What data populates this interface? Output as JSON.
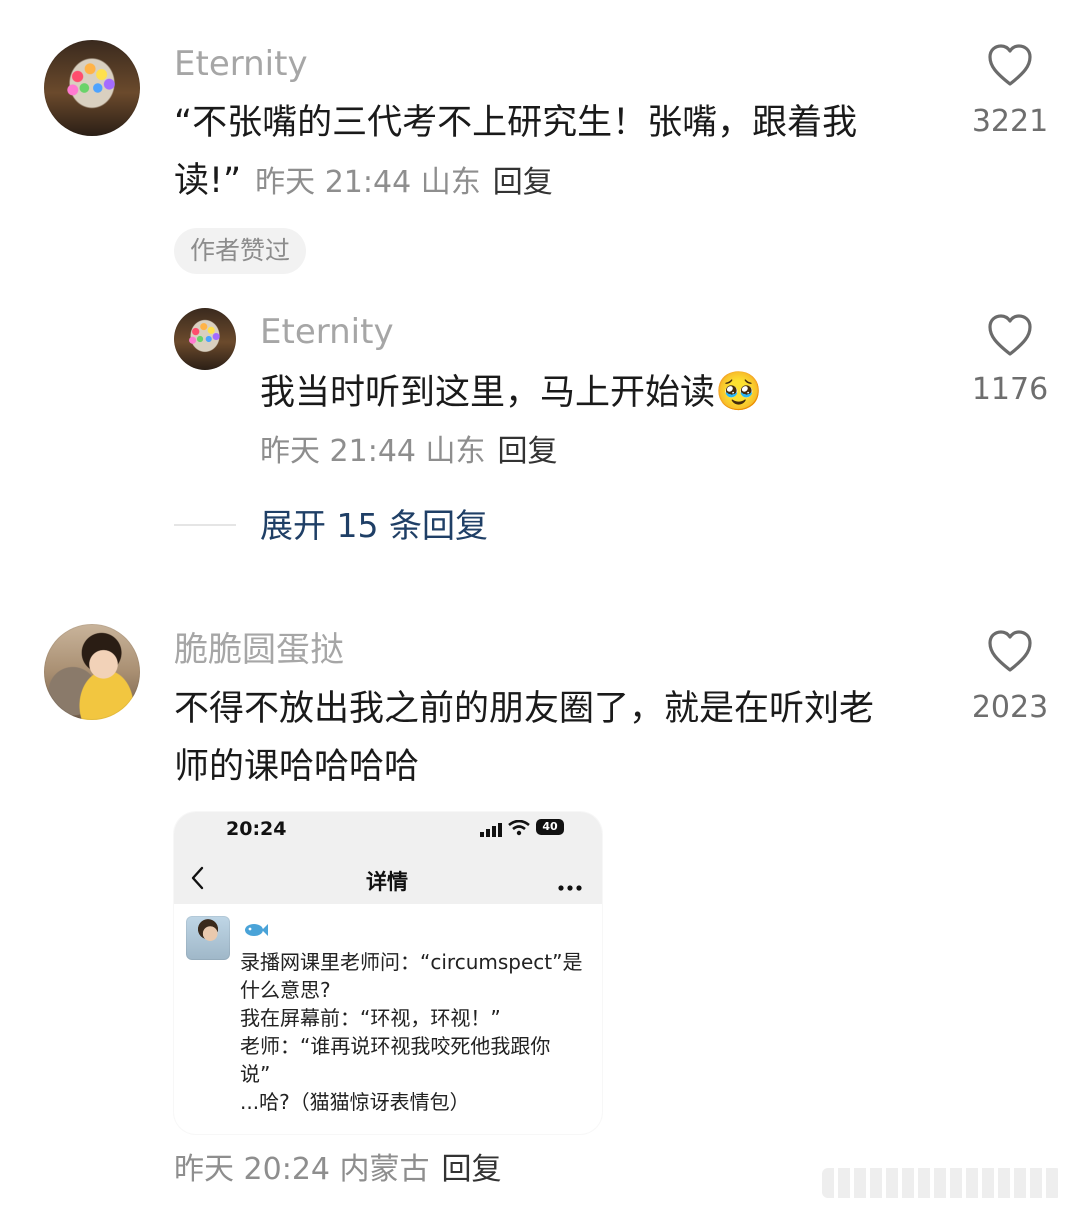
{
  "comment1": {
    "username": "Eternity",
    "text_line1": "“不张嘴的三代考不上研究生！张嘴，跟着我",
    "text_line2": "读!”",
    "meta": "昨天 21:44 山东",
    "reply": "回复",
    "badge": "作者赞过",
    "likes": "3221"
  },
  "reply1": {
    "username": "Eternity",
    "text": "我当时听到这里，马上开始读",
    "emoji": "🥹",
    "meta": "昨天 21:44 山东",
    "reply": "回复",
    "likes": "1176"
  },
  "expand": {
    "label": "展开 15 条回复"
  },
  "comment2": {
    "username": "脆脆圆蛋挞",
    "text_line1": "不得不放出我之前的朋友圈了，就是在听刘老",
    "text_line2": "师的课哈哈哈哈",
    "meta": "昨天 20:24 内蒙古",
    "reply": "回复",
    "likes": "2023",
    "embedded": {
      "status_time": "20:24",
      "battery": "40",
      "title": "详情",
      "post_lines": [
        "录播网课里老师问：“circumspect”是",
        "什么意思?",
        "我在屏幕前：“环视，环视！”",
        "老师：“谁再说环视我咬死他我跟你",
        "说”",
        "...哈?（猫猫惊讶表情包）"
      ]
    }
  }
}
